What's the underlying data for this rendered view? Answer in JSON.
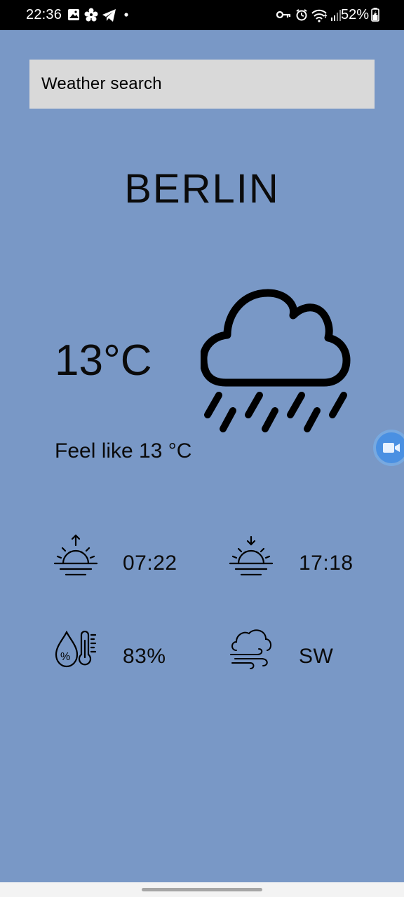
{
  "status_bar": {
    "time": "22:36",
    "battery_percent": "52%",
    "left_icons": [
      "image-icon",
      "settings-flower-icon",
      "telegram-icon",
      "dot-icon"
    ],
    "right_icons": [
      "key-icon",
      "alarm-icon",
      "wifi-icon",
      "signal-icon",
      "battery-icon"
    ]
  },
  "search": {
    "label": "Weather search"
  },
  "weather": {
    "city": "BERLIN",
    "temperature": "13°C",
    "feels_like": "Feel like 13 °C",
    "condition_icon": "rain-cloud-icon"
  },
  "details": {
    "sunrise": "07:22",
    "sunset": "17:18",
    "humidity": "83%",
    "wind_direction": "SW",
    "icons": {
      "sunrise": "sunrise-icon",
      "sunset": "sunset-icon",
      "humidity": "humidity-thermometer-icon",
      "wind": "wind-cloud-icon"
    }
  },
  "colors": {
    "background": "#7998c6",
    "search_box": "#d9d9d9",
    "status_bar": "#000000",
    "float_button": "#4a90e2"
  }
}
